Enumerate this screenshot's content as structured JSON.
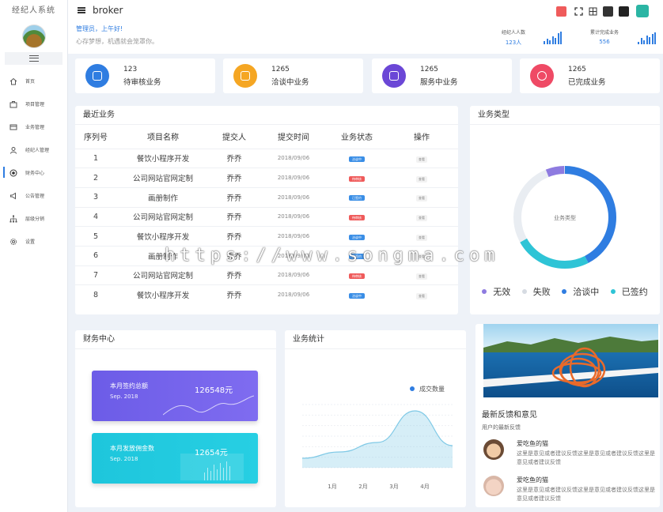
{
  "sidebar": {
    "brand": "经纪人系统",
    "items": [
      {
        "label": "首页",
        "icon": "home-icon"
      },
      {
        "label": "项目管理",
        "icon": "briefcase-icon"
      },
      {
        "label": "业务管理",
        "icon": "card-icon"
      },
      {
        "label": "经纪人管理",
        "icon": "user-icon"
      },
      {
        "label": "财务中心",
        "icon": "radio-icon"
      },
      {
        "label": "公告管理",
        "icon": "megaphone-icon"
      },
      {
        "label": "层级分销",
        "icon": "sitemap-icon"
      },
      {
        "label": "设置",
        "icon": "gear-icon"
      }
    ]
  },
  "header": {
    "title": "broker",
    "greeting": "管理员，上午好!",
    "motto": "心存梦想，机遇就会笼罩你。",
    "stat1": {
      "label": "经纪人人数",
      "value": "123人"
    },
    "stat2": {
      "label": "累计完成业务",
      "value": "556"
    }
  },
  "summary": [
    {
      "num": "123",
      "label": "待审核业务",
      "color": "#2f7de1"
    },
    {
      "num": "1265",
      "label": "洽谈中业务",
      "color": "#f5a623"
    },
    {
      "num": "1265",
      "label": "服务中业务",
      "color": "#6b47d6"
    },
    {
      "num": "1265",
      "label": "已完成业务",
      "color": "#ef4a65"
    }
  ],
  "recent": {
    "title": "最近业务",
    "headers": [
      "序列号",
      "项目名称",
      "提交人",
      "提交时间",
      "业务状态",
      "操作"
    ],
    "rows": [
      {
        "id": "1",
        "name": "餐饮小程序开发",
        "user": "乔乔",
        "date": "2018/09/06",
        "status": "洽谈中",
        "statusColor": "#3a8ee6",
        "op": "查看"
      },
      {
        "id": "2",
        "name": "公司网站官网定制",
        "user": "乔乔",
        "date": "2018/09/06",
        "status": "待审核",
        "statusColor": "#ef5b5b",
        "op": "查看"
      },
      {
        "id": "3",
        "name": "画册制作",
        "user": "乔乔",
        "date": "2018/09/06",
        "status": "已签约",
        "statusColor": "#3a8ee6",
        "op": "查看"
      },
      {
        "id": "4",
        "name": "公司网站官网定制",
        "user": "乔乔",
        "date": "2018/09/06",
        "status": "待审核",
        "statusColor": "#ef5b5b",
        "op": "查看"
      },
      {
        "id": "5",
        "name": "餐饮小程序开发",
        "user": "乔乔",
        "date": "2018/09/06",
        "status": "洽谈中",
        "statusColor": "#3a8ee6",
        "op": "查看"
      },
      {
        "id": "6",
        "name": "画册制作",
        "user": "乔乔",
        "date": "2018/09/06",
        "status": "已签约",
        "statusColor": "#3a8ee6",
        "op": "查看"
      },
      {
        "id": "7",
        "name": "公司网站官网定制",
        "user": "乔乔",
        "date": "2018/09/06",
        "status": "待审核",
        "statusColor": "#ef5b5b",
        "op": "查看"
      },
      {
        "id": "8",
        "name": "餐饮小程序开发",
        "user": "乔乔",
        "date": "2018/09/06",
        "status": "洽谈中",
        "statusColor": "#3a8ee6",
        "op": "查看"
      }
    ]
  },
  "business_type": {
    "title": "业务类型",
    "center_label": "业务类型",
    "legend": [
      {
        "label": "无效",
        "color": "#8e7be0"
      },
      {
        "label": "失败",
        "color": "#d6dbe2"
      },
      {
        "label": "洽谈中",
        "color": "#2f7de1"
      },
      {
        "label": "已签约",
        "color": "#2ec4d6"
      }
    ]
  },
  "finance": {
    "title": "财务中心",
    "card1": {
      "title": "本月签约总额",
      "date": "Sep. 2018",
      "amount": "126548元",
      "color": "#6c5ce7"
    },
    "card2": {
      "title": "本月发放佣金数",
      "date": "Sep. 2018",
      "amount": "12654元",
      "color": "#1ec6dc"
    }
  },
  "chart_data": {
    "type": "area",
    "title": "业务统计",
    "xlabel": "",
    "ylabel": "",
    "categories": [
      "1月",
      "2月",
      "3月",
      "4月"
    ],
    "series": [
      {
        "name": "成交数量",
        "values": [
          3,
          5,
          8,
          18,
          7
        ]
      }
    ],
    "grid": true,
    "legend": "top-right"
  },
  "feedback": {
    "title": "最新反馈和意见",
    "subtitle": "用户的最新反馈",
    "items": [
      {
        "name": "爱吃鱼的猫",
        "text": "这里是意见或者建议反馈这里是意见或者建议反馈这里是意见或者建议反馈"
      },
      {
        "name": "爱吃鱼的猫",
        "text": "这里是意见或者建议反馈这里是意见或者建议反馈这里是意见或者建议反馈"
      }
    ]
  },
  "watermark": "https://www.songma.com"
}
